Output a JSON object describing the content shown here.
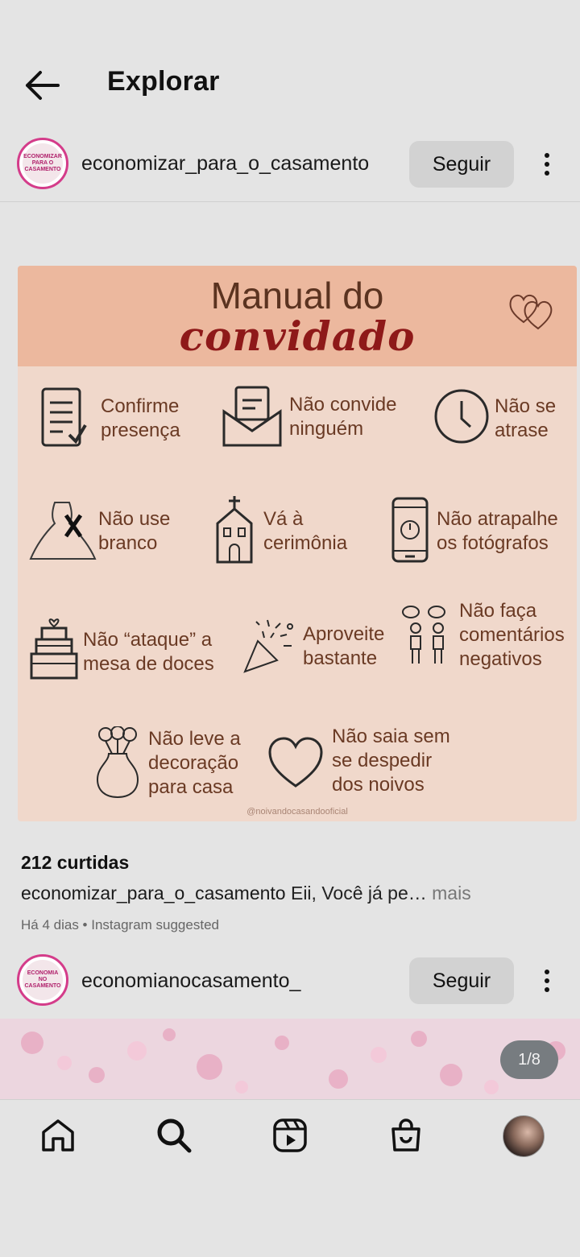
{
  "header": {
    "title": "Explorar"
  },
  "post1": {
    "username": "economizar_para_o_casamento",
    "avatar_text": "ECONOMIZAR PARA O CASAMENTO",
    "follow_label": "Seguir",
    "image": {
      "title_line1": "Manual do",
      "title_line2": "convidado",
      "items": [
        {
          "icon": "checklist-icon",
          "label": "Confirme presença"
        },
        {
          "icon": "envelope-icon",
          "label": "Não convide ninguém"
        },
        {
          "icon": "clock-icon",
          "label": "Não se atrase"
        },
        {
          "icon": "dress-icon",
          "label": "Não use branco"
        },
        {
          "icon": "church-icon",
          "label": "Vá à cerimônia"
        },
        {
          "icon": "phone-icon",
          "label": "Não atrapalhe os fotógrafos"
        },
        {
          "icon": "cake-icon",
          "label": "Não “ataque” a mesa de doces"
        },
        {
          "icon": "party-popper-icon",
          "label": "Aproveite bastante"
        },
        {
          "icon": "people-talking-icon",
          "label": "Não faça comentários negativos"
        },
        {
          "icon": "vase-icon",
          "label": "Não leve a decoração para casa"
        },
        {
          "icon": "heart-icon",
          "label": "Não saia sem se despedir dos noivos"
        }
      ],
      "credit": "@noivandocasandooficial"
    },
    "likes": "212 curtidas",
    "caption_user": "economizar_para_o_casamento",
    "caption_text": "Eii, Você já pe…",
    "caption_more": "mais",
    "timestamp": "Há 4 dias • Instagram suggested"
  },
  "post2": {
    "username": "economianocasamento_",
    "avatar_text": "ECONOMIA NO CASAMENTO",
    "follow_label": "Seguir",
    "pager": "1/8"
  },
  "nav": {
    "items": [
      "home-icon",
      "search-icon",
      "reels-icon",
      "shop-icon",
      "profile-avatar"
    ]
  },
  "colors": {
    "accent_ring": "#d43c8a",
    "card_header": "#ecb89e",
    "card_bg": "#f0d8cb",
    "title_red": "#8e1919"
  }
}
